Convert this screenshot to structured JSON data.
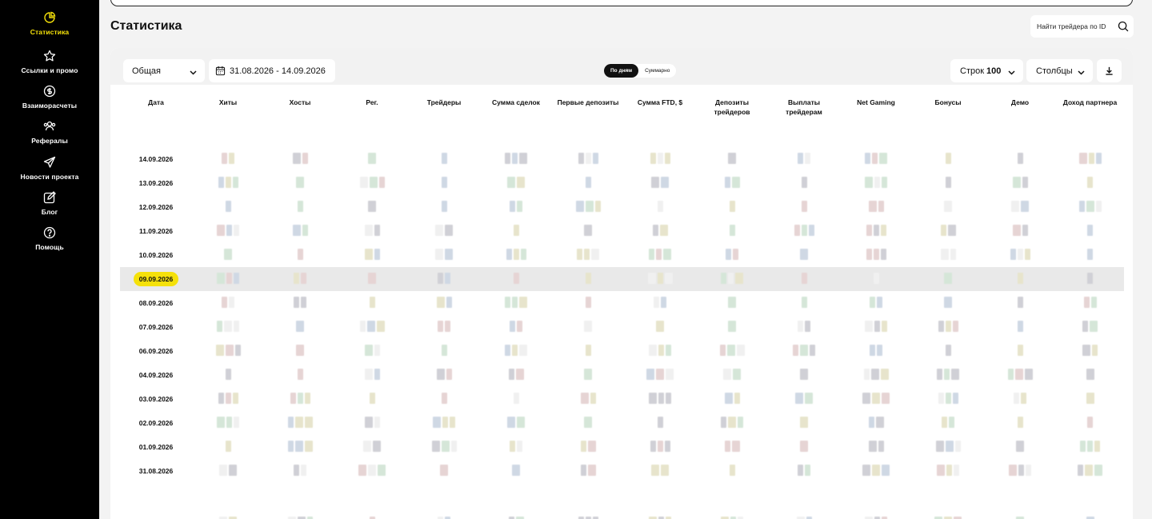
{
  "sidebar": {
    "items": [
      {
        "label": "Статистика",
        "icon": "pie-chart-icon",
        "active": true
      },
      {
        "label": "Ссылки и промо",
        "icon": "star-icon",
        "active": false
      },
      {
        "label": "Взаиморасчеты",
        "icon": "dollar-circle-icon",
        "active": false
      },
      {
        "label": "Рефералы",
        "icon": "users-icon",
        "active": false
      },
      {
        "label": "Новости проекта",
        "icon": "send-icon",
        "active": false
      },
      {
        "label": "Блог",
        "icon": "edit-icon",
        "active": false
      },
      {
        "label": "Помощь",
        "icon": "help-icon",
        "active": false
      }
    ]
  },
  "page": {
    "title": "Статистика"
  },
  "search": {
    "placeholder": "Найти трейдера по ID",
    "icon": "search-icon"
  },
  "filters": {
    "type_select": "Общая",
    "date_range": "31.08.2026 - 14.09.2026",
    "view_toggle": {
      "by_days": "По дням",
      "summary": "Суммарно",
      "selected": "by_days"
    },
    "rows_label": "Строк",
    "rows_value": "100",
    "columns_label": "Столбцы"
  },
  "table": {
    "headers": [
      "Дата",
      "Хиты",
      "Хосты",
      "Рег.",
      "Трейдеры",
      "Сумма сделок",
      "Первые депозиты",
      "Сумма FTD, $",
      "Депозиты трейдеров",
      "Выплаты трейдерам",
      "Net Gaming",
      "Бонусы",
      "Демо",
      "Доход партнера"
    ],
    "rows": [
      {
        "date": "14.09.2026"
      },
      {
        "date": "13.09.2026"
      },
      {
        "date": "12.09.2026"
      },
      {
        "date": "11.09.2026"
      },
      {
        "date": "10.09.2026"
      },
      {
        "date": "09.09.2026",
        "highlighted": true
      },
      {
        "date": "08.09.2026"
      },
      {
        "date": "07.09.2026"
      },
      {
        "date": "06.09.2026"
      },
      {
        "date": "04.09.2026"
      },
      {
        "date": "03.09.2026"
      },
      {
        "date": "02.09.2026"
      },
      {
        "date": "01.09.2026"
      },
      {
        "date": "31.08.2026"
      }
    ]
  },
  "colors": {
    "accent": "#f5e10a",
    "sidebar_bg": "#000000",
    "highlight_row": "#e9e9e9"
  }
}
